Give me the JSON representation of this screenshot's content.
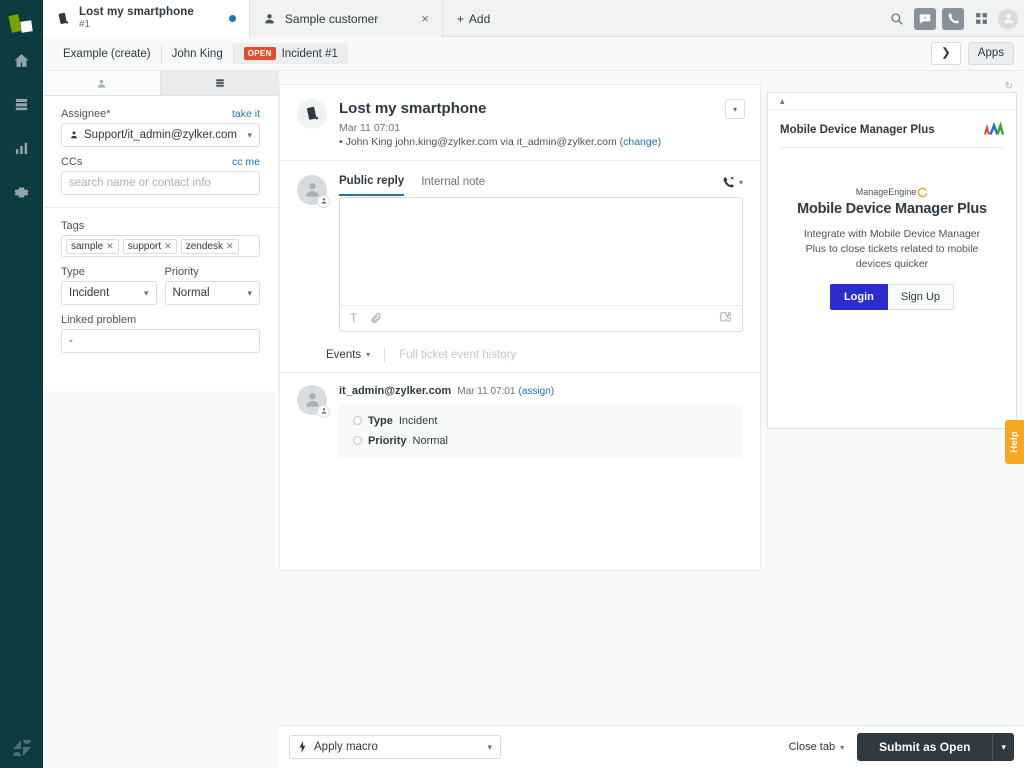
{
  "rail": {
    "logo_name": "zendesk-logo",
    "items": [
      {
        "name": "home",
        "icon": "home-icon"
      },
      {
        "name": "views",
        "icon": "views-icon"
      },
      {
        "name": "reporting",
        "icon": "reporting-icon"
      },
      {
        "name": "admin",
        "icon": "gear-icon"
      }
    ],
    "footer_logo": "zendesk-z-logo"
  },
  "topbar": {
    "tabs": [
      {
        "title": "Lost my smartphone",
        "sub": "#1",
        "icon": "smartphone-icon",
        "active": true,
        "status_dot": true
      },
      {
        "title": "Sample customer",
        "icon": "user-icon",
        "active": false,
        "close": "×"
      }
    ],
    "add_label": "Add",
    "add_icon": "plus-icon",
    "icons": [
      {
        "name": "search-icon"
      },
      {
        "name": "chat-icon"
      },
      {
        "name": "talk-icon"
      },
      {
        "name": "apps-grid-icon"
      },
      {
        "name": "user-avatar-icon"
      }
    ]
  },
  "breadcrumb": {
    "items": [
      {
        "label": "Example (create)"
      },
      {
        "label": "John King"
      },
      {
        "label": "Incident #1",
        "badge": "OPEN"
      }
    ],
    "expand_icon": "chevron-right-icon",
    "apps_label": "Apps"
  },
  "properties": {
    "tabs": [
      {
        "name": "user-tab",
        "icon": "user-icon",
        "active": true
      },
      {
        "name": "fields-tab",
        "icon": "ticket-fields-icon",
        "active": false
      }
    ],
    "assignee": {
      "label": "Assignee*",
      "action": "take it",
      "value": "Support/it_admin@zylker.com",
      "icon": "assignee-icon"
    },
    "ccs": {
      "label": "CCs",
      "action": "cc me",
      "placeholder": "search name or contact info",
      "value": ""
    },
    "tags": {
      "label": "Tags",
      "chips": [
        "sample",
        "support",
        "zendesk"
      ]
    },
    "type": {
      "label": "Type",
      "value": "Incident"
    },
    "priority": {
      "label": "Priority",
      "value": "Normal"
    },
    "linked_problem": {
      "label": "Linked problem",
      "value": "-"
    }
  },
  "ticket": {
    "icon": "smartphone-icon",
    "title": "Lost my smartphone",
    "date": "Mar 11 07:01",
    "requester_prefix": "• John King john.king@zylker.com via it_admin@zylker.com",
    "change_link": "(change)",
    "menu_icon": "chevron-down-icon",
    "composer": {
      "tabs": [
        {
          "label": "Public reply",
          "active": true
        },
        {
          "label": "Internal note",
          "active": false
        }
      ],
      "channel_icon": "call-icon",
      "channel_chevron": "chevron-down-icon",
      "body": "",
      "toolbar": [
        {
          "name": "text-format-icon",
          "glyph": "T"
        },
        {
          "name": "attachment-icon"
        }
      ],
      "toolbar_right": {
        "name": "apps-puzzle-icon"
      }
    },
    "events": {
      "label": "Events",
      "chevron": "chevron-down-icon",
      "history_label": "Full ticket event history",
      "entry": {
        "author": "it_admin@zylker.com",
        "time": "Mar 11 07:01",
        "action_link": "(assign)",
        "changes": [
          {
            "field": "Type",
            "value": "Incident"
          },
          {
            "field": "Priority",
            "value": "Normal"
          }
        ]
      }
    }
  },
  "apps_panel": {
    "refresh_icon": "refresh-icon",
    "collapse_icon": "chevron-up-icon",
    "app_title": "Mobile Device Manager Plus",
    "app_logo": "mdm-logo-icon",
    "brand": "ManageEngine",
    "product": "Mobile Device Manager Plus",
    "description": "Integrate with Mobile Device Manager Plus to close tickets related to mobile devices quicker",
    "login_label": "Login",
    "signup_label": "Sign Up",
    "login_color": "#2c2ccc"
  },
  "help_tab": {
    "label": "Help",
    "color": "#f5a623"
  },
  "bottombar": {
    "macro_label": "Apply macro",
    "macro_icon": "lightning-icon",
    "macro_chevron": "chevron-down-icon",
    "close_tab_label": "Close tab",
    "close_tab_chevron": "chevron-down-icon",
    "submit_label": "Submit as Open",
    "submit_chevron": "chevron-down-icon",
    "submit_color": "#2f3941"
  }
}
